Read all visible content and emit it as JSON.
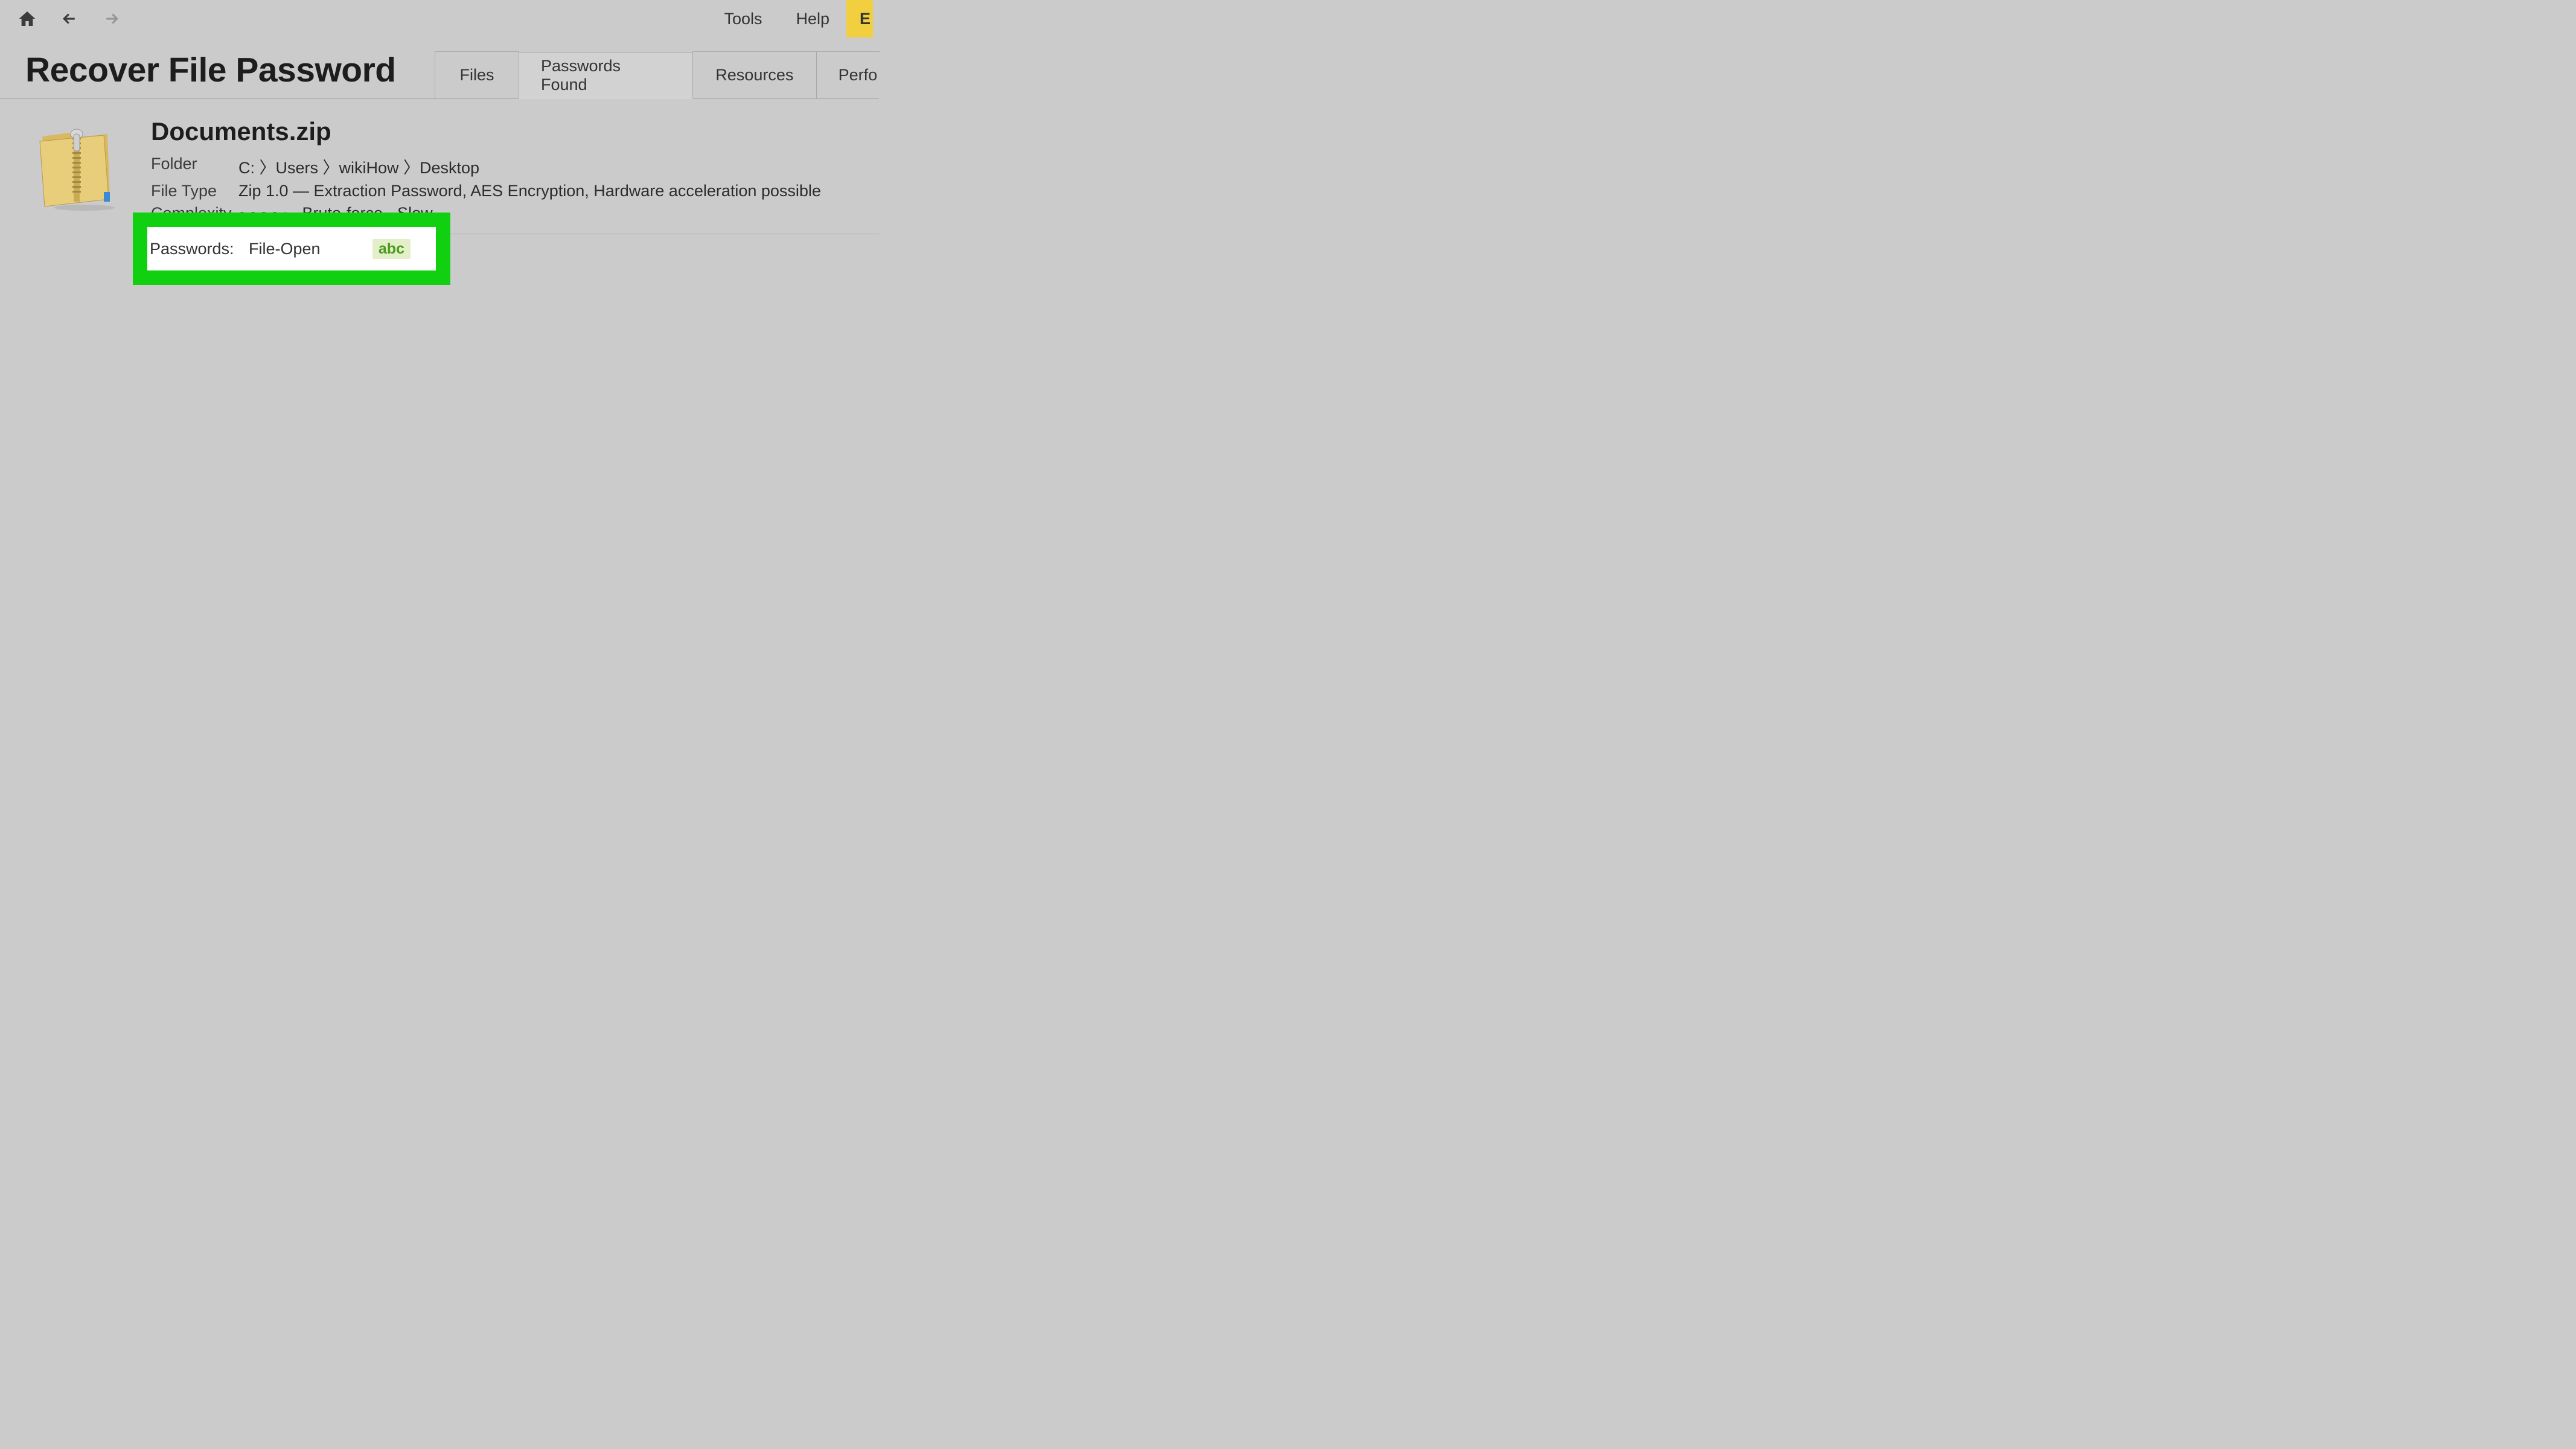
{
  "toolbar": {
    "menu_tools": "Tools",
    "menu_help": "Help",
    "e_button": "E"
  },
  "page_title": "Recover File Password",
  "tabs": {
    "files": "Files",
    "passwords_found": "Passwords Found",
    "resources": "Resources",
    "performance": "Perfo"
  },
  "file": {
    "name": "Documents.zip",
    "folder_label": "Folder",
    "folder_value": "C: 〉Users 〉wikiHow 〉Desktop",
    "filetype_label": "File Type",
    "filetype_value": "Zip 1.0 — Extraction Password, AES Encryption, Hardware acceleration possible",
    "complexity_label": "Complexity",
    "complexity_value": "Brute-force - Slow",
    "complexity_filled_dots": 4,
    "complexity_total_dots": 5
  },
  "passwords": {
    "label": "Passwords:",
    "value": "File-Open",
    "badge": "abc"
  },
  "colors": {
    "highlight_green": "#10d010",
    "badge_bg": "#e3efc8",
    "badge_fg": "#4a9b1f",
    "accent_yellow": "#f2cf3e"
  }
}
